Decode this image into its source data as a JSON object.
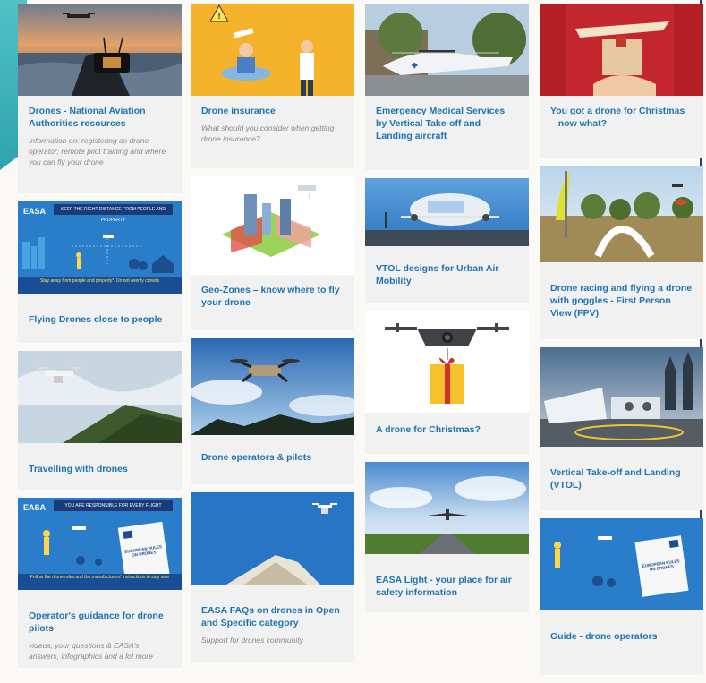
{
  "cards": {
    "drones_naa": {
      "title": "Drones - National Aviation Authorities resources",
      "desc": "Information on: registering as drone operator; remote pilot training and where you can fly your drone"
    },
    "flying_close": {
      "title": "Flying Drones close to people",
      "img_banner": "KEEP THE RIGHT DISTANCE FROM PEOPLE AND PROPERTY",
      "img_bottom": "Stay away from people and property*. Do not overfly crowds",
      "logo": "EASA"
    },
    "travelling": {
      "title": "Travelling with drones"
    },
    "operators_guidance": {
      "title": "Operator's guidance for drone pilots",
      "desc": "videos, your questions & EASA's answers, infographics and a lot more",
      "img_banner": "YOU ARE RESPONSIBLE FOR EVERY FLIGHT",
      "img_bottom": "Follow the drone rules and the manufacturers' instructions to stay safe",
      "book": "EUROPEAN RULES ON DRONES",
      "logo": "EASA"
    },
    "insurance": {
      "title": "Drone insurance",
      "desc": "What should you consider when getting drone insurance?"
    },
    "geozones": {
      "title": "Geo-Zones – know where to fly your drone"
    },
    "operators_pilots": {
      "title": "Drone operators & pilots"
    },
    "faqs": {
      "title": "EASA FAQs on drones in Open and Specific category",
      "desc": "Support for drones community"
    },
    "ems": {
      "title": "Emergency Medical Services by Vertical Take-off and Landing aircraft"
    },
    "vtol_designs": {
      "title": "VTOL designs for Urban Air Mobility"
    },
    "christmas": {
      "title": "A drone for Christmas?"
    },
    "easa_light": {
      "title": "EASA Light - your place for air safety information"
    },
    "got_drone": {
      "title": "You got a drone for Christmas – now what?"
    },
    "racing": {
      "title": "Drone racing and flying a drone with goggles - First Person View (FPV)"
    },
    "vtol": {
      "title": "Vertical Take-off and Landing (VTOL)"
    },
    "guide": {
      "title": "Guide - drone operators",
      "book": "EUROPEAN RULES ON DRONES"
    }
  },
  "colors": {
    "title": "#1e74b0",
    "card_bg": "#f1f1f1",
    "accent": "#4fc2c6"
  }
}
